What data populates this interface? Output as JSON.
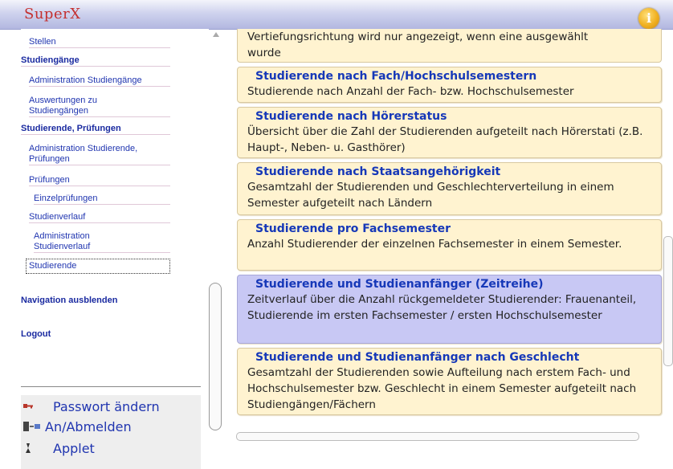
{
  "app": {
    "logo": "SuperX"
  },
  "header": {
    "info_icon": "info-icon"
  },
  "sidebar": {
    "stellen": "Stellen",
    "studiengaenge": "Studiengänge",
    "admin_studiengaenge": "Administration Studiengänge",
    "auswertungen_1": "Auswertungen zu",
    "auswertungen_2": "Studiengängen",
    "studierende_pruefungen": "Studierende, Prüfungen",
    "admin_studierende_1": "Administration Studierende,",
    "admin_studierende_2": "Prüfungen",
    "pruefungen": "Prüfungen",
    "einzelpruefungen": "Einzelprüfungen",
    "studienverlauf": "Studienverlauf",
    "admin_studienverlauf_1": "Administration",
    "admin_studienverlauf_2": "Studienverlauf",
    "studierende": "Studierende",
    "navigation_ausblenden": "Navigation ausblenden",
    "logout": "Logout",
    "tools": [
      {
        "label": "Passwort ändern",
        "icon": "key-icon"
      },
      {
        "label": "An/Abmelden",
        "icon": "login-icon"
      },
      {
        "label": "Applet",
        "icon": "applet-icon"
      }
    ]
  },
  "main": {
    "top_card": {
      "line1": "Vertiefungsrichtung wird nur angezeigt, wenn eine ausgewählt",
      "line2": "wurde"
    },
    "cards": [
      {
        "title": "Studierende nach Fach/Hochschulsemestern",
        "desc": "Studierende nach Anzahl der Fach- bzw. Hochschulsemester"
      },
      {
        "title": "Studierende nach Hörerstatus",
        "desc": "Übersicht über die Zahl der Studierenden aufgeteilt nach Hörerstati (z.B. Haupt-, Neben- u. Gasthörer)"
      },
      {
        "title": "Studierende nach Staatsangehörigkeit",
        "desc": "Gesamtzahl der Studierenden und Geschlechterverteilung in einem Semester aufgeteilt nach Ländern"
      },
      {
        "title": "Studierende pro Fachsemester",
        "desc": "Anzahl Studierender der einzelnen Fachsemester in einem Semester."
      },
      {
        "title": "Studierende und Studienanfänger (Zeitreihe)",
        "desc": "Zeitverlauf über die Anzahl rückgemeldeter Studierender: Frauenanteil, Studierende im ersten Fachsemester / ersten Hochschulsemester"
      },
      {
        "title": "Studierende und Studienanfänger nach Geschlecht",
        "desc": "Gesamtzahl der Studierenden sowie Aufteilung nach erstem Fach- und Hochschulsemester bzw. Geschlecht in einem Semester aufgeteilt nach Studiengängen/Fächern"
      }
    ]
  },
  "colors": {
    "card_bg": "#fff3d0",
    "card_active_bg": "#c8c8f4",
    "link": "#2035b0",
    "title": "#1638b8",
    "logo": "#c43030"
  }
}
